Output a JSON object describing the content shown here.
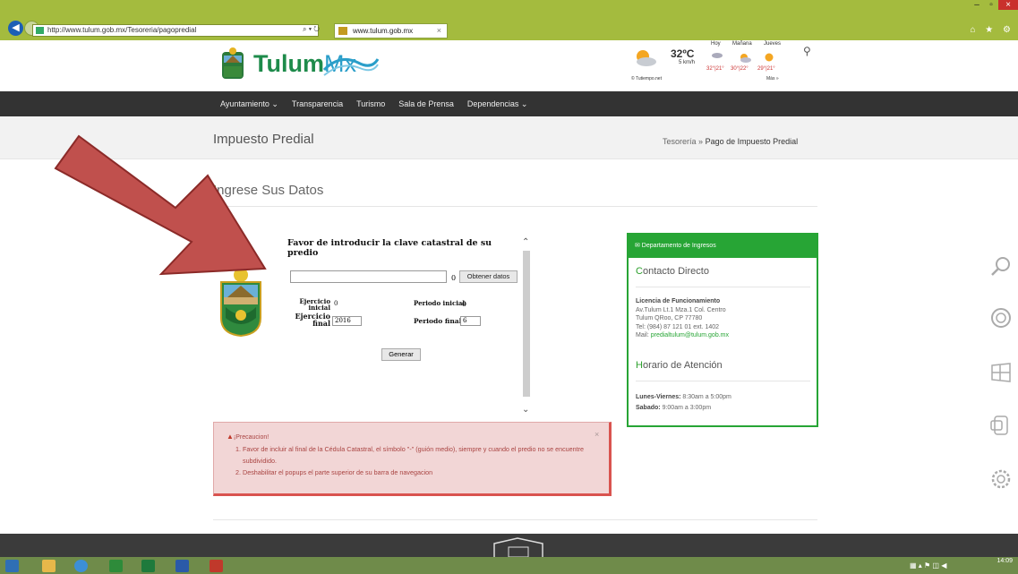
{
  "browser": {
    "url": "http://www.tulum.gob.mx/Tesoreria/pagopredial",
    "address_tools": "⌕ ▾ ↻",
    "tab_title": "www.tulum.gob.mx",
    "tab_close": "×",
    "back": "◀",
    "window_controls": [
      "–",
      "▫",
      "×"
    ],
    "toolbar_icons": "⌂ ★ ⚙"
  },
  "site": {
    "logo_main": "Tulum",
    "logo_suffix": "Mx",
    "weather": {
      "temp": "32ºC",
      "wind": "5 km/h",
      "days": [
        "Hoy",
        "Mañana",
        "Jueves"
      ],
      "temps": [
        "32°|21°",
        "30°|22°",
        "29°|21°"
      ],
      "source": "© Tutiempo.net",
      "more": "Más »"
    },
    "search_icon": "⚲"
  },
  "nav": {
    "items": [
      "Ayuntamiento ⌄",
      "Transparencia",
      "Turismo",
      "Sala de Prensa",
      "Dependencias ⌄"
    ]
  },
  "page": {
    "title": "Impuesto Predial",
    "breadcrumb_parent": "Tesorería",
    "breadcrumb_sep": "»",
    "breadcrumb_current": "Pago de Impuesto Predial",
    "section_title_first": "I",
    "section_title_rest": "ngrese Sus Datos"
  },
  "form": {
    "heading": "Favor de introducir la clave catastral de su predio",
    "clave_value": "",
    "clave_suffix": "0",
    "obtener_label": "Obtener datos",
    "ejercicio_inicial_label": "Ejercicio inicial",
    "ejercicio_inicial_value": "0",
    "periodo_inicial_label": "Periodo inicial",
    "periodo_inicial_value": "0",
    "ejercicio_final_label": "Ejercicio final",
    "ejercicio_final_value": "2016",
    "periodo_final_label": "Periodo final",
    "periodo_final_value": "6",
    "generar_label": "Generar",
    "scroll_up": "⌃",
    "scroll_down": "⌄"
  },
  "alert": {
    "title": "¡Precaucion!",
    "close": "×",
    "items": [
      "Favor de incluir al final de la Cédula Catastral, el símbolo \"-\" (guión medio), siempre y cuando el predio no se encuentre subdividido.",
      "Deshabilitar el popups el parte superior de su barra de navegacion"
    ]
  },
  "panel": {
    "header": "✉ Departamento de Ingresos",
    "contacto_first": "C",
    "contacto_rest": "ontacto Directo",
    "licencia_title": "Licencia de Funcionamiento",
    "address1": "Av.Tulum Lt.1 Mza.1 Col. Centro",
    "address2": "Tulum QRoo, CP 77780",
    "tel": "Tel: (984) 87 121 01 ext. 1402",
    "mail_label": "Mail: ",
    "mail": "predialtulum@tulum.gob.mx",
    "horario_first": "H",
    "horario_rest": "orario de Atención",
    "weekday_label": "Lunes-Viernes:",
    "weekday_hours": " 8:30am a 5:00pm",
    "saturday_label": "Sabado:",
    "saturday_hours": " 9:00am a 3:00pm"
  },
  "taskbar": {
    "time": "14:09",
    "tray": "▦ ▴ ⚑ ◫ ◀"
  },
  "colors": {
    "accent_green": "#27a535",
    "nav_dark": "#333333",
    "chrome_green": "#a4bb3e",
    "alert_red": "#d9534f",
    "arrow_red": "#c0504d"
  }
}
